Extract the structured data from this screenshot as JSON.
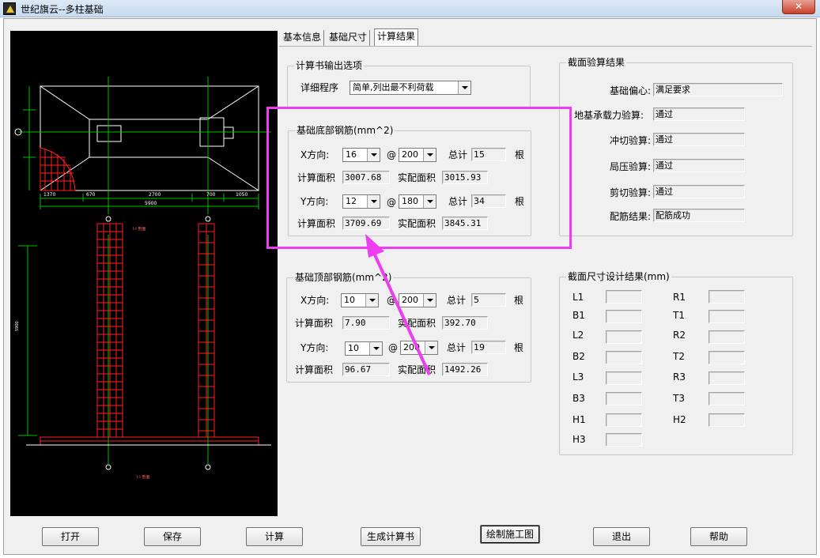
{
  "window": {
    "title": "世纪旗云--多柱基础",
    "close_label": "✕"
  },
  "tabs": [
    {
      "label": "基本信息"
    },
    {
      "label": "基础尺寸"
    },
    {
      "label": "计算结果"
    }
  ],
  "output_options": {
    "group_label": "计算书输出选项",
    "detail_label": "详细程序",
    "detail_value": "简单,列出最不利荷载"
  },
  "bottom_rebar": {
    "group_label": "基础底部钢筋(mm^2)",
    "x_label": "X方向:",
    "x_dia": "16",
    "x_spacing": "200",
    "x_total_label": "总计",
    "x_total": "15",
    "x_unit": "根",
    "x_calc_label": "计算面积",
    "x_calc": "3007.68",
    "x_actual_label": "实配面积",
    "x_actual": "3015.93",
    "y_label": "Y方向:",
    "y_dia": "12",
    "y_spacing": "180",
    "y_total_label": "总计",
    "y_total": "34",
    "y_unit": "根",
    "y_calc_label": "计算面积",
    "y_calc": "3709.69",
    "y_actual_label": "实配面积",
    "y_actual": "3845.31",
    "at": "@"
  },
  "top_rebar": {
    "group_label": "基础顶部钢筋(mm^2)",
    "x_label": "X方向:",
    "x_dia": "10",
    "x_spacing": "200",
    "x_total_label": "总计",
    "x_total": "5",
    "x_unit": "根",
    "x_calc_label": "计算面积",
    "x_calc": "7.90",
    "x_actual_label": "实配面积",
    "x_actual": "392.70",
    "y_label": "Y方向:",
    "y_dia": "10",
    "y_spacing": "200",
    "y_total_label": "总计",
    "y_total": "19",
    "y_unit": "根",
    "y_calc_label": "计算面积",
    "y_calc": "96.67",
    "y_actual_label": "实配面积",
    "y_actual": "1492.26",
    "at": "@"
  },
  "section_check": {
    "group_label": "截面验算结果",
    "rows": [
      {
        "label": "基础偏心:",
        "value": "满足要求"
      },
      {
        "label": "地基承载力验算:",
        "value": "通过"
      },
      {
        "label": "冲切验算:",
        "value": "通过"
      },
      {
        "label": "局压验算:",
        "value": "通过"
      },
      {
        "label": "剪切验算:",
        "value": "通过"
      },
      {
        "label": "配筋结果:",
        "value": "配筋成功"
      }
    ]
  },
  "size_design": {
    "group_label": "截面尺寸设计结果(mm)",
    "left": [
      "L1",
      "B1",
      "L2",
      "B2",
      "L3",
      "B3",
      "H1",
      "H3"
    ],
    "right": [
      "R1",
      "T1",
      "R2",
      "T2",
      "R3",
      "T3",
      "H2"
    ]
  },
  "buttons": {
    "open": "打开",
    "save": "保存",
    "calc": "计算",
    "report": "生成计算书",
    "draw": "绘制施工图",
    "exit": "退出",
    "help": "帮助"
  },
  "drawing": {
    "dim_1": "1370",
    "dim_2": "670",
    "dim_3": "2700",
    "dim_4": "700",
    "dim_5": "1050",
    "dim_total": "5900",
    "section_1": "I-I 剖面",
    "section_2": "I-I 剖面",
    "height_dim": "5900"
  },
  "colors": {
    "highlight": "#ee3cf0",
    "cad_green": "#00c000",
    "cad_red": "#ff2020"
  }
}
